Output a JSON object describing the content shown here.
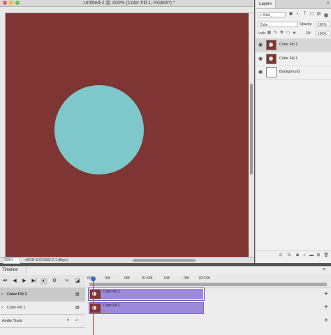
{
  "window": {
    "title": "Untitled-2 @ 300% (Color Fill 1, RGB/8*) *",
    "traffic_lights": {
      "close": "#ee5f57",
      "minimize": "#f4be3b",
      "maximize": "#5fc84b"
    }
  },
  "canvas": {
    "background_color": "#7f3533",
    "shape_color": "#7ec8cb",
    "shape": "circle"
  },
  "statusbar": {
    "zoom": "300%",
    "doc_info": "sRGB IEC61966-2.1 (8bpc)"
  },
  "layers_panel": {
    "tab_label": "Layers",
    "filter_kind": "Kind",
    "blend_mode": "Color",
    "opacity_label": "Opacity:",
    "opacity_value": "100%",
    "lock_label": "Lock:",
    "fill_label": "Fill:",
    "fill_value": "100%",
    "layers": [
      {
        "name": "Color Fill 1",
        "selected": true,
        "thumb": "red-circle"
      },
      {
        "name": "Color Fill 1",
        "selected": false,
        "thumb": "red-circle"
      },
      {
        "name": "Background",
        "selected": false,
        "thumb": "white"
      }
    ],
    "footer_icons": [
      "link-icon",
      "fx-icon",
      "mask-icon",
      "adjustment-icon",
      "group-icon",
      "new-layer-icon",
      "trash-icon"
    ],
    "footer_fx": "fx"
  },
  "timeline": {
    "tab_label": "Timeline",
    "ruler_ticks": [
      "00",
      "04f",
      "08f",
      "01:00f",
      "04f",
      "08f",
      "02:00f"
    ],
    "tracks": [
      {
        "label": "Color Fill 1",
        "clip_label": "Color Fill 1",
        "selected": true
      },
      {
        "label": "Color Fill 1",
        "clip_label": "Color Fill 1",
        "selected": false
      }
    ],
    "audio_track_label": "Audio Track"
  }
}
